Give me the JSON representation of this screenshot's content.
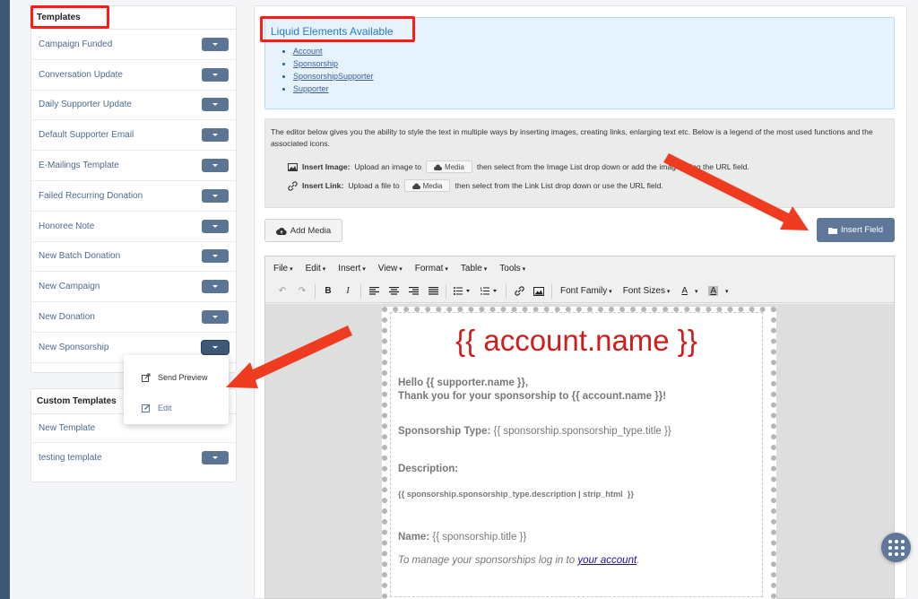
{
  "templates": {
    "title": "Templates",
    "items": [
      {
        "name": "Campaign Funded"
      },
      {
        "name": "Conversation Update"
      },
      {
        "name": "Daily Supporter Update"
      },
      {
        "name": "Default Supporter Email"
      },
      {
        "name": "E-Mailings Template"
      },
      {
        "name": "Failed Recurring Donation"
      },
      {
        "name": "Honoree Note"
      },
      {
        "name": "New Batch Donation"
      },
      {
        "name": "New Campaign"
      },
      {
        "name": "New Donation"
      },
      {
        "name": "New Sponsorship"
      }
    ]
  },
  "dropdown": {
    "send_preview": "Send Preview",
    "edit": "Edit"
  },
  "custom_templates": {
    "title": "Custom Templates",
    "items": [
      {
        "name": "New Template"
      },
      {
        "name": "testing template"
      }
    ]
  },
  "liquid": {
    "title": "Liquid Elements Available",
    "items": [
      "Account",
      "Sponsorship",
      "SponsorshipSupporter",
      "Supporter"
    ]
  },
  "info": {
    "paragraph": "The editor below gives you the ability to style the text in multiple ways by inserting images, creating links, enlarging text etc. Below is a legend of the most used functions and the associated icons.",
    "image_label": "Insert Image:",
    "image_pre": "Upload an image to",
    "image_post": "then select from the Image List drop down or add the image using the URL field.",
    "link_label": "Insert Link:",
    "link_pre": "Upload a file to",
    "link_post": "then select from the Link List drop down or use the URL field.",
    "media": "Media"
  },
  "buttons": {
    "add_media": "Add Media",
    "insert_field": "Insert Field"
  },
  "editor": {
    "menu": [
      "File",
      "Edit",
      "Insert",
      "View",
      "Format",
      "Table",
      "Tools"
    ],
    "font_family": "Font Family",
    "font_sizes": "Font Sizes"
  },
  "document": {
    "heading": "{{ account.name }}",
    "greeting": "Hello {{ supporter.name }},",
    "thanks": "Thank you for your sponsorship to {{ account.name }}!",
    "type_label": "Sponsorship Type:",
    "type_value": "{{ sponsorship.sponsorship_type.title }}",
    "description_label": "Description:",
    "description_value": "{{ sponsorship.sponsorship_type.description | strip_html  }}",
    "name_label": "Name:",
    "name_value": "{{ sponsorship.title }}",
    "manage_text": "To manage your sponsorships log in to",
    "manage_link": "your account",
    "manage_end": "."
  },
  "colors": {
    "highlight": "#ff1a1a",
    "accent": "#5f7798",
    "heading_red": "#d01e1e",
    "link_blue": "#2a7bc6",
    "sidebar": "#3a5878"
  }
}
